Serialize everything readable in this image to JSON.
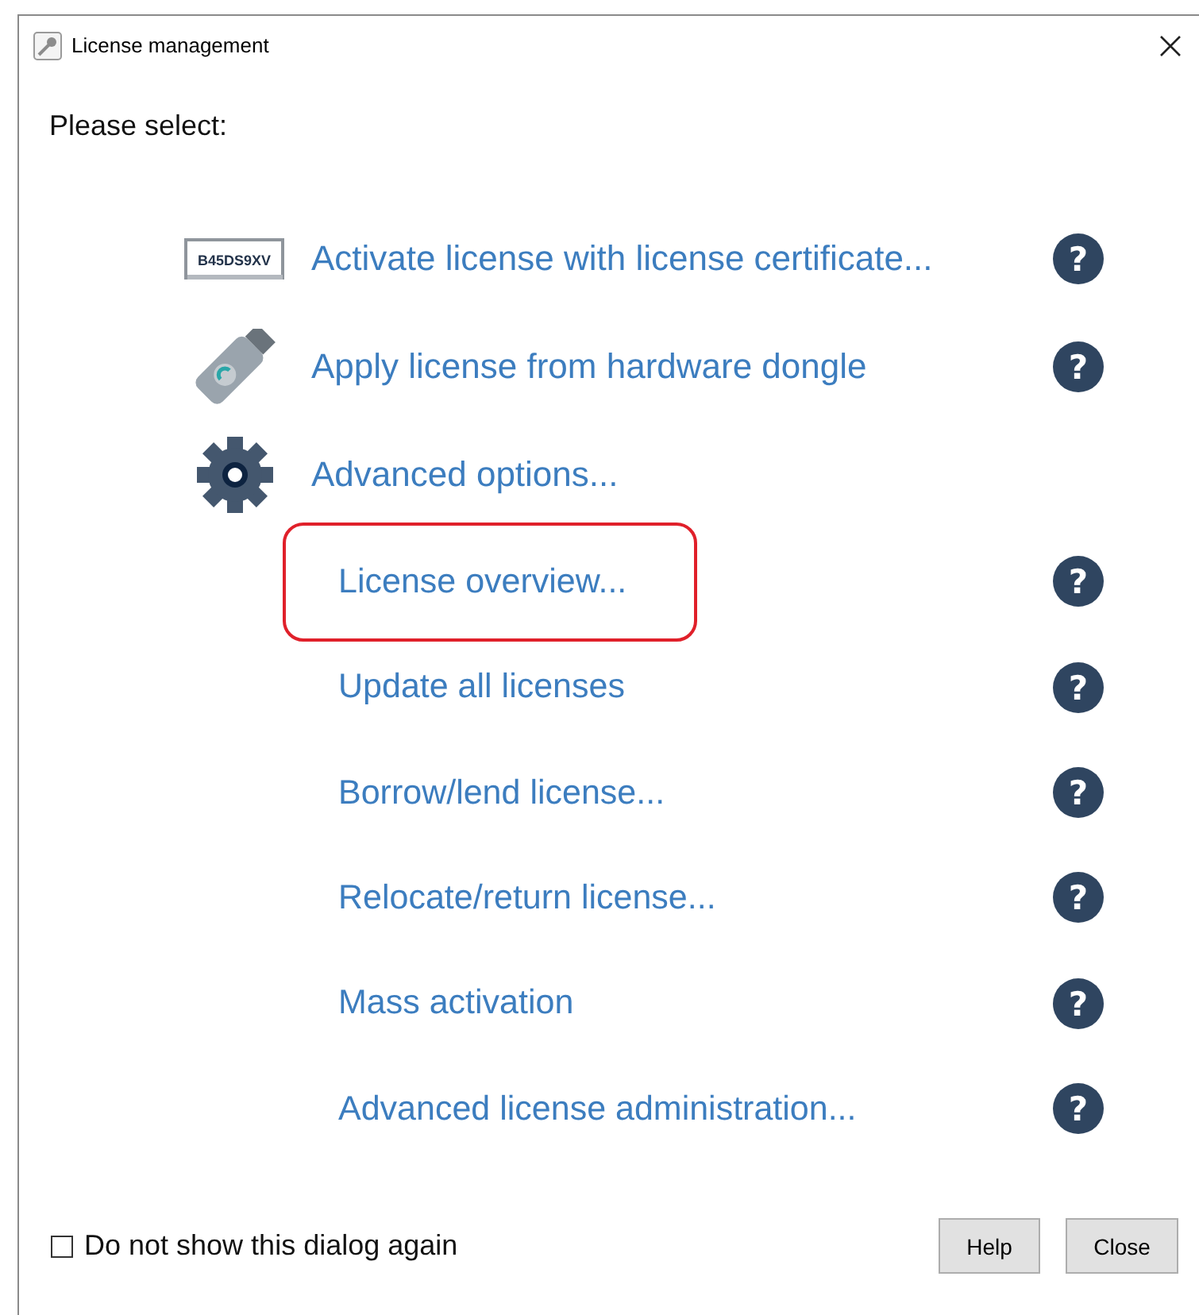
{
  "window": {
    "title": "License management"
  },
  "prompt": "Please select:",
  "options": [
    {
      "kind": "certificate",
      "label": "Activate license with license certificate...",
      "icon_text": "B45DS9XV",
      "help": "?"
    },
    {
      "kind": "dongle",
      "label": "Apply license from hardware dongle",
      "help": "?"
    },
    {
      "kind": "gear",
      "label": "Advanced options..."
    }
  ],
  "advanced_options": [
    {
      "label": "License overview...",
      "highlighted": true,
      "help": "?"
    },
    {
      "label": "Update all licenses",
      "highlighted": false,
      "help": "?"
    },
    {
      "label": "Borrow/lend license...",
      "highlighted": false,
      "help": "?"
    },
    {
      "label": "Relocate/return license...",
      "highlighted": false,
      "help": "?"
    },
    {
      "label": "Mass activation",
      "highlighted": false,
      "help": "?"
    },
    {
      "label": "Advanced license administration...",
      "highlighted": false,
      "help": "?"
    }
  ],
  "footer": {
    "checkbox": {
      "label": "Do not show this dialog again",
      "checked": false
    },
    "buttons": [
      "Help",
      "Close"
    ]
  }
}
